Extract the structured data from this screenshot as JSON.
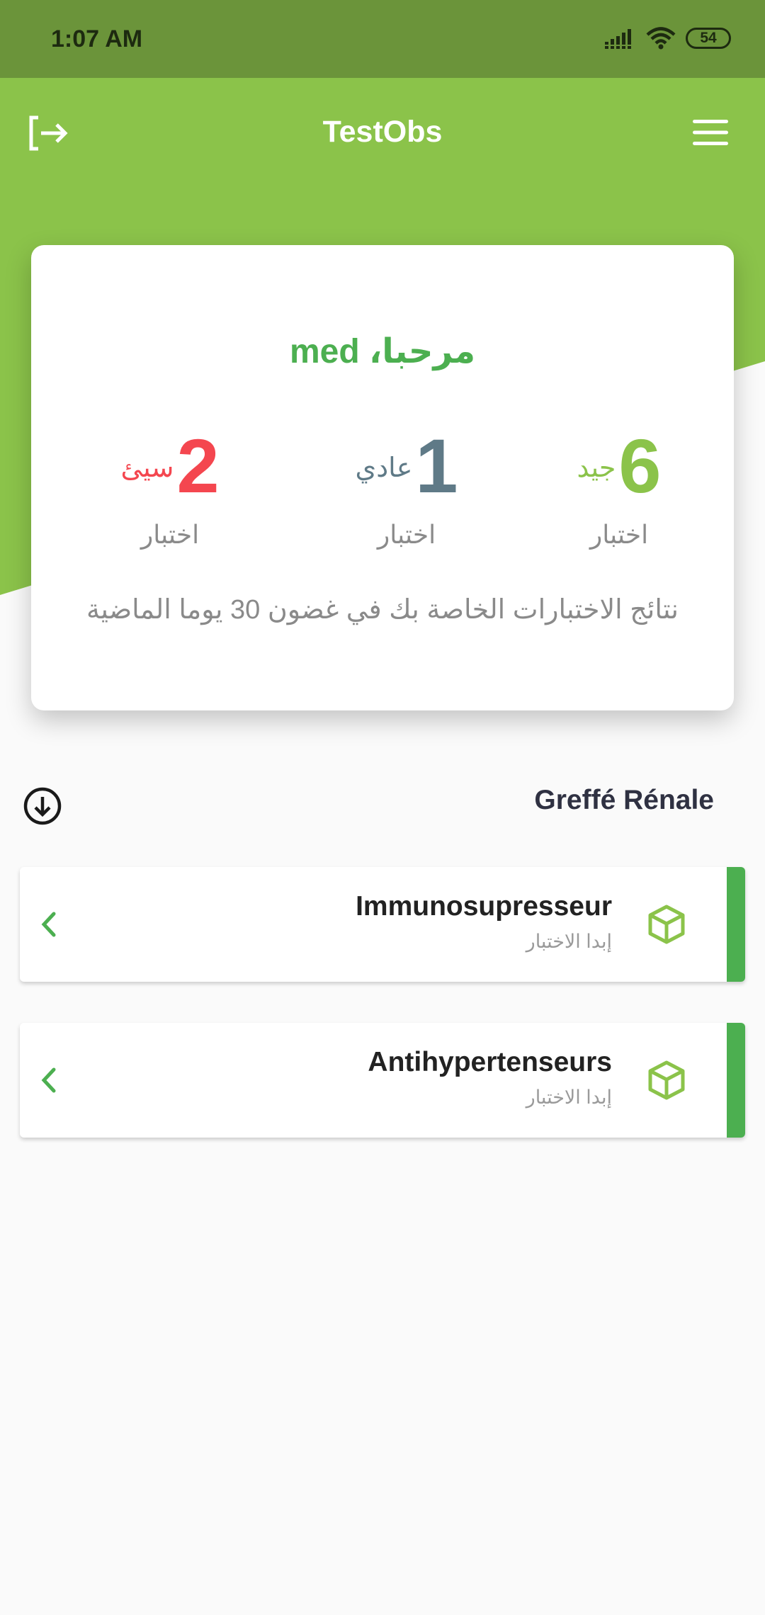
{
  "status_bar": {
    "time": "1:07 AM",
    "battery": "54"
  },
  "header": {
    "title": "TestObs",
    "logout_icon": "logout-icon",
    "menu_icon": "hamburger-menu-icon"
  },
  "summary": {
    "greeting": "مرحبا، med",
    "stats": {
      "good": {
        "value": "6",
        "label": "جيد",
        "unit": "اختبار",
        "color": "#8bc34a"
      },
      "normal": {
        "value": "1",
        "label": "عادي",
        "unit": "اختبار",
        "color": "#5f7a87"
      },
      "bad": {
        "value": "2",
        "label": "سيئ",
        "unit": "اختبار",
        "color": "#f4464f"
      }
    },
    "note": "نتائج الاختبارات الخاصة بك في غضون 30 يوما الماضية"
  },
  "section": {
    "title": "Greffé Rénale",
    "download_icon": "download-circle-icon"
  },
  "tests": [
    {
      "title": "Immunosupresseur",
      "subtitle": "إبدا الاختبار",
      "icon": "cube-icon"
    },
    {
      "title": "Antihypertenseurs",
      "subtitle": "إبدا الاختبار",
      "icon": "cube-icon"
    }
  ],
  "colors": {
    "header": "#8bc34a",
    "status_bar": "#6b943a",
    "accent": "#4caf50"
  }
}
